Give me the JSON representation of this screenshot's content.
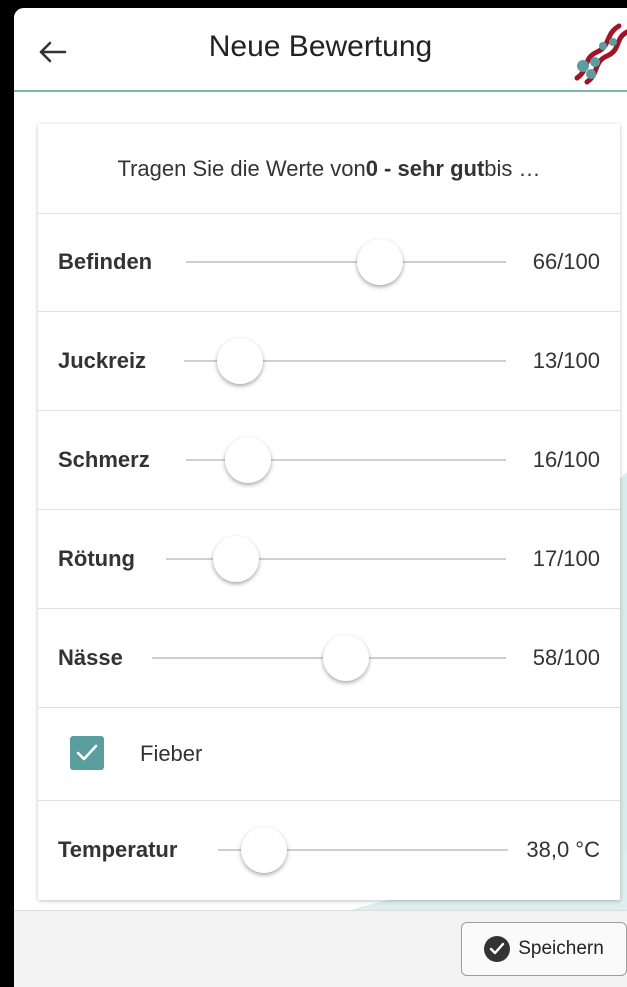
{
  "header": {
    "title": "Neue Bewertung",
    "back_icon": "arrow-left-icon",
    "logo_icon": "dna-helix-logo"
  },
  "intro": {
    "text_before": "Tragen Sie die Werte von ",
    "text_bold": "0 - sehr gut",
    "text_after": " bis …"
  },
  "sliders": [
    {
      "label": "Befinden",
      "value": 66,
      "display": "66/100"
    },
    {
      "label": "Juckreiz",
      "value": 13,
      "display": "13/100"
    },
    {
      "label": "Schmerz",
      "value": 16,
      "display": "16/100"
    },
    {
      "label": "Rötung",
      "value": 17,
      "display": "17/100"
    },
    {
      "label": "Nässe",
      "value": 58,
      "display": "58/100"
    }
  ],
  "fever": {
    "label": "Fieber",
    "checked": true
  },
  "temperature": {
    "label": "Temperatur",
    "display": "38,0 °C"
  },
  "footer": {
    "save_label": "Speichern",
    "save_icon": "check-circle-icon"
  },
  "colors": {
    "accent": "#5a9e9f",
    "header_border": "#7fb6b3",
    "logo_red": "#a0142a"
  }
}
